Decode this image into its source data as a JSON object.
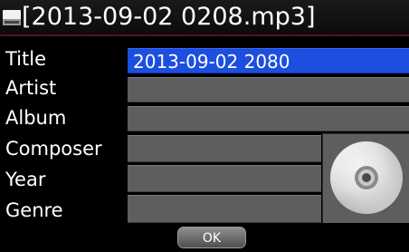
{
  "header": {
    "title": "[2013-09-02 0208.mp3]",
    "icon": "disk-icon"
  },
  "fields": [
    {
      "label": "Title",
      "value": "2013-09-02 2080",
      "selected": true
    },
    {
      "label": "Artist",
      "value": ""
    },
    {
      "label": "Album",
      "value": ""
    },
    {
      "label": "Composer",
      "value": ""
    },
    {
      "label": "Year",
      "value": ""
    },
    {
      "label": "Genre",
      "value": ""
    }
  ],
  "album_art": {
    "icon": "cd-icon"
  },
  "ok_label": "OK",
  "colors": {
    "background": "#000000",
    "field": "#5e5e5e",
    "selected_field": "#1c4fe0",
    "accent_line": "#5b1020"
  }
}
